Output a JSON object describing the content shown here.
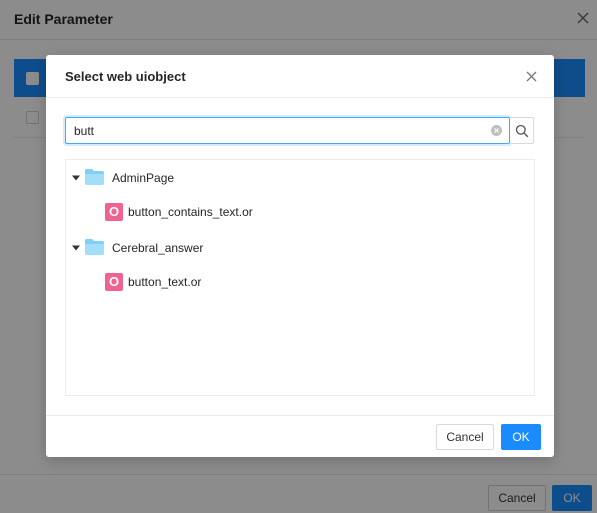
{
  "background_window": {
    "title": "Edit Parameter",
    "cancel_label": "Cancel",
    "ok_label": "OK",
    "header_color": "#1a8cff"
  },
  "dialog": {
    "title": "Select web uiobject",
    "search": {
      "value": "butt"
    },
    "tree": [
      {
        "folder": "AdminPage",
        "icon": "folder-icon",
        "expanded": true,
        "children": [
          {
            "badge": "O",
            "label": "button_contains_text.or"
          }
        ]
      },
      {
        "folder": "Cerebral_answer",
        "icon": "folder-icon",
        "expanded": true,
        "children": [
          {
            "badge": "O",
            "label": "button_text.or"
          }
        ]
      }
    ],
    "cancel_label": "Cancel",
    "ok_label": "OK"
  },
  "colors": {
    "primary": "#1a8cff",
    "object_badge": "#f06292",
    "folder": "#7fd0f5"
  }
}
